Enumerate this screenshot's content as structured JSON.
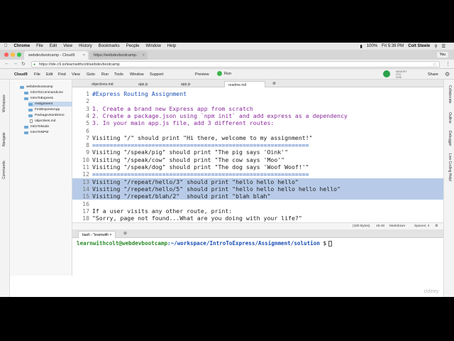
{
  "mac_menu": {
    "items": [
      "Chrome",
      "File",
      "Edit",
      "View",
      "History",
      "Bookmarks",
      "People",
      "Window",
      "Help"
    ],
    "battery": "100%",
    "clock": "Fri 5:39 PM",
    "user": "Colt Steele"
  },
  "browser": {
    "tabs": [
      {
        "label": "webdevbootcamp - Cloud9",
        "active": true
      },
      {
        "label": "https://webdevbootcamp-",
        "active": false
      }
    ],
    "profile": "You",
    "url": "https://ide.c9.io/learnwithcolt/webdevbootcamp"
  },
  "c9_menu": {
    "brand": "Cloud9",
    "items": [
      "File",
      "Edit",
      "Find",
      "View",
      "Goto",
      "Run",
      "Tools",
      "Window",
      "Support"
    ],
    "preview": "Preview",
    "run": "Run",
    "share": "Share",
    "stats": [
      "MEMORY",
      "CPU",
      "DISK"
    ]
  },
  "left_panel_labels": [
    "Workspace",
    "Navigate",
    "Commands"
  ],
  "right_panel_labels": [
    "Collaborate",
    "Outline",
    "Debugger",
    "Live Coding Help!"
  ],
  "file_tree": [
    {
      "name": "webdevbootcamp",
      "type": "folder",
      "depth": 0,
      "selected": false
    },
    {
      "name": "IntroToCommandLine",
      "type": "folder",
      "depth": 1,
      "selected": false
    },
    {
      "name": "IntroToExpress",
      "type": "folder",
      "depth": 1,
      "selected": false
    },
    {
      "name": "Assignment",
      "type": "folder",
      "depth": 2,
      "selected": true
    },
    {
      "name": "FirstExpressApp",
      "type": "folder",
      "depth": 2,
      "selected": false
    },
    {
      "name": "PackageJsonDemo",
      "type": "folder",
      "depth": 2,
      "selected": false
    },
    {
      "name": "objectives.md",
      "type": "file",
      "depth": 2,
      "selected": false
    },
    {
      "name": "IntroToNode",
      "type": "folder",
      "depth": 1,
      "selected": false
    },
    {
      "name": "IntroToNPM",
      "type": "folder",
      "depth": 1,
      "selected": false
    }
  ],
  "editor_tabs": [
    {
      "label": "objectives.md",
      "active": false
    },
    {
      "label": "app.js",
      "active": false
    },
    {
      "label": "app.js",
      "active": false
    },
    {
      "label": "readme.md",
      "active": true
    }
  ],
  "editor_lines": [
    {
      "n": "1",
      "text": "#Express Routing Assignment",
      "style": "blue",
      "hl": false
    },
    {
      "n": "2",
      "text": "",
      "style": "",
      "hl": false
    },
    {
      "n": "3",
      "text": "1. Create a brand new Express app from scratch",
      "style": "purple",
      "hl": false
    },
    {
      "n": "4",
      "text": "2. Create a package.json using `npm init` and add express as a dependency",
      "style": "purple",
      "hl": false
    },
    {
      "n": "5",
      "text": "3. In your main app.js file, add 3 different routes:",
      "style": "purple",
      "hl": false
    },
    {
      "n": "6",
      "text": "",
      "style": "",
      "hl": false
    },
    {
      "n": "7",
      "text": "Visiting \"/\" should print \"Hi there, welcome to my assignment!\"",
      "style": "",
      "hl": false
    },
    {
      "n": "8",
      "text": "==============================================================",
      "style": "blue",
      "hl": false
    },
    {
      "n": "9",
      "text": "Visiting \"/speak/pig\" should print \"The pig says 'Oink'\"",
      "style": "",
      "hl": false
    },
    {
      "n": "10",
      "text": "Visiting \"/speak/cow\" should print \"The cow says 'Moo'\"",
      "style": "",
      "hl": false
    },
    {
      "n": "11",
      "text": "Visiting \"/speak/dog\" should print \"The dog says 'Woof Woof!'\"",
      "style": "",
      "hl": false
    },
    {
      "n": "12",
      "text": "==============================================================",
      "style": "blue",
      "hl": false
    },
    {
      "n": "13",
      "text": "Visiting \"/repeat/hello/3\" should print \"hello hello hello\"",
      "style": "",
      "hl": true
    },
    {
      "n": "14",
      "text": "Visiting \"/repeat/hello/5\" should print \"hello hello hello hello hello\"",
      "style": "",
      "hl": true
    },
    {
      "n": "15",
      "text": "Visiting \"/repeat/blah/2\"  should print \"blah blah\"",
      "style": "",
      "hl": true
    },
    {
      "n": "16",
      "text": "",
      "style": "",
      "hl": false
    },
    {
      "n": "17",
      "text": "If a user visits any other route, print:",
      "style": "",
      "hl": false
    },
    {
      "n": "18",
      "text": "\"Sorry, page not found...What are you doing with your life?\"",
      "style": "",
      "hl": false
    }
  ],
  "status_bar": {
    "size": "(180 Bytes)",
    "position": "15:49",
    "mode": "Markdown",
    "indent": "Spaces: 4"
  },
  "terminal": {
    "tab_label": "bash - \"learnwith",
    "user": "learnwithcolt@webdevbootcamp",
    "path": ":~/workspace/IntroToExpress/Assignment/solution",
    "symbol": "$"
  },
  "watermark": "Udemy"
}
